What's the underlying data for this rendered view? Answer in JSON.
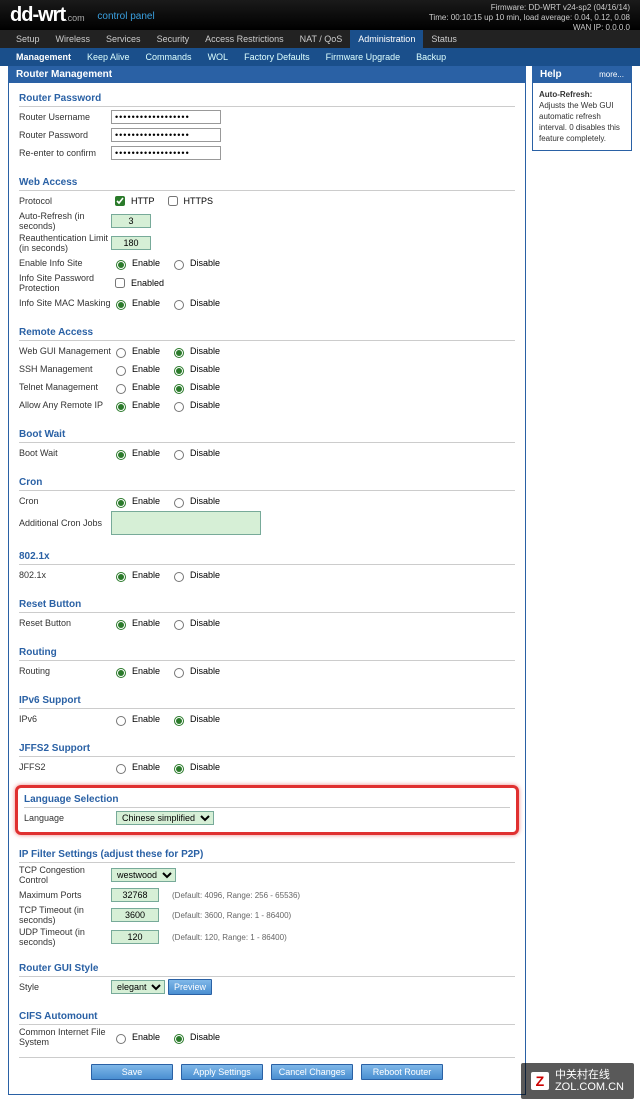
{
  "header": {
    "logo_dd": "dd",
    "logo_wrt": "-wrt",
    "logo_com": ".com",
    "control_panel": "control panel",
    "firmware": "Firmware: DD-WRT v24-sp2 (04/16/14)",
    "uptime": "Time: 00:10:15 up 10 min, load average: 0.04, 0.12, 0.08",
    "wan": "WAN IP: 0.0.0.0"
  },
  "tabs": [
    "Setup",
    "Wireless",
    "Services",
    "Security",
    "Access Restrictions",
    "NAT / QoS",
    "Administration",
    "Status"
  ],
  "active_tab": 6,
  "subtabs": [
    "Management",
    "Keep Alive",
    "Commands",
    "WOL",
    "Factory Defaults",
    "Firmware Upgrade",
    "Backup"
  ],
  "active_subtab": 0,
  "page_title": "Router Management",
  "help": {
    "title": "Help",
    "more": "more...",
    "heading": "Auto-Refresh:",
    "body": "Adjusts the Web GUI automatic refresh interval. 0 disables this feature completely."
  },
  "sections": {
    "router_password": {
      "title": "Router Password",
      "username_lbl": "Router Username",
      "username_val": "••••••••••••••••••",
      "password_lbl": "Router Password",
      "password_val": "••••••••••••••••••",
      "confirm_lbl": "Re-enter to confirm",
      "confirm_val": "••••••••••••••••••"
    },
    "web_access": {
      "title": "Web Access",
      "protocol_lbl": "Protocol",
      "http": "HTTP",
      "https": "HTTPS",
      "autorefresh_lbl": "Auto-Refresh (in seconds)",
      "autorefresh_val": "3",
      "reauth_lbl": "Reauthentication Limit (in seconds)",
      "reauth_val": "180",
      "enable_info_lbl": "Enable Info Site",
      "info_pw_lbl": "Info Site Password Protection",
      "info_pw_cb": "Enabled",
      "mac_mask_lbl": "Info Site MAC Masking"
    },
    "remote": {
      "title": "Remote Access",
      "web_lbl": "Web GUI Management",
      "ssh_lbl": "SSH Management",
      "telnet_lbl": "Telnet Management",
      "anyip_lbl": "Allow Any Remote IP"
    },
    "boot": {
      "title": "Boot Wait",
      "lbl": "Boot Wait"
    },
    "cron": {
      "title": "Cron",
      "lbl": "Cron",
      "jobs_lbl": "Additional Cron Jobs"
    },
    "dot1x": {
      "title": "802.1x",
      "lbl": "802.1x"
    },
    "reset": {
      "title": "Reset Button",
      "lbl": "Reset Button"
    },
    "routing": {
      "title": "Routing",
      "lbl": "Routing"
    },
    "ipv6": {
      "title": "IPv6 Support",
      "lbl": "IPv6"
    },
    "jffs2": {
      "title": "JFFS2 Support",
      "lbl": "JFFS2"
    },
    "lang": {
      "title": "Language Selection",
      "lbl": "Language",
      "val": "Chinese simplified"
    },
    "ipfilter": {
      "title": "IP Filter Settings (adjust these for P2P)",
      "tcc_lbl": "TCP Congestion Control",
      "tcc_val": "westwood",
      "maxports_lbl": "Maximum Ports",
      "maxports_val": "32768",
      "maxports_note": "(Default: 4096, Range: 256 - 65536)",
      "tcpto_lbl": "TCP Timeout (in seconds)",
      "tcpto_val": "3600",
      "tcpto_note": "(Default: 3600, Range: 1 - 86400)",
      "udpto_lbl": "UDP Timeout (in seconds)",
      "udpto_val": "120",
      "udpto_note": "(Default: 120, Range: 1 - 86400)"
    },
    "gui": {
      "title": "Router GUI Style",
      "lbl": "Style",
      "val": "elegant",
      "preview": "Preview"
    },
    "cifs": {
      "title": "CIFS Automount",
      "lbl": "Common Internet File System"
    }
  },
  "common": {
    "enable": "Enable",
    "disable": "Disable"
  },
  "buttons": {
    "save": "Save",
    "apply": "Apply Settings",
    "cancel": "Cancel Changes",
    "reboot": "Reboot Router"
  },
  "watermark": {
    "line1": "中关村在线",
    "line2": "ZOL.COM.CN"
  }
}
